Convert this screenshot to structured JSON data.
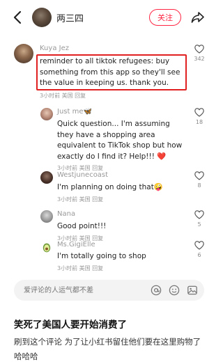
{
  "header": {
    "author_name": "两三四",
    "follow_label": "关注"
  },
  "comments": [
    {
      "user": "Kuya Jez",
      "text": "reminder to all tiktok refugees:  buy something from this app so they'll see the value in keeping us. thank you.",
      "meta": "3小时前 美国 回复",
      "likes": "342"
    },
    {
      "user": "Just me🦋",
      "text": "Quick question... I'm assuming they have a shopping area equivalent to TikTok shop but how exactly do I find it? Help!!! ❤️",
      "meta": "3小时前 美国 回复",
      "likes": "18"
    },
    {
      "user": "Westjunecoast",
      "text": "I'm planning on doing that🤪",
      "meta": "3小时前 美国 回复",
      "likes": "8"
    },
    {
      "user": "Nana",
      "text": "Good point!!!",
      "meta": "3小时前 美国 回复",
      "likes": "5"
    },
    {
      "user": "Ms.GigiElle",
      "text": "I'm totally going to shop",
      "meta": "3小时前 美国 回复",
      "likes": "6"
    }
  ],
  "input": {
    "placeholder": "爱评论的人运气都不差"
  },
  "post": {
    "title": "笑死了美国人要开始消费了",
    "body": "刷到这个评论 为了让小红书留住他们要在这里购物了哈哈哈"
  },
  "colors": {
    "accent": "#ff2442",
    "highlight": "#e02020",
    "muted": "#999999"
  },
  "icons": [
    "back-arrow-icon",
    "share-icon",
    "heart-icon",
    "at-icon",
    "emoji-icon",
    "image-icon"
  ]
}
